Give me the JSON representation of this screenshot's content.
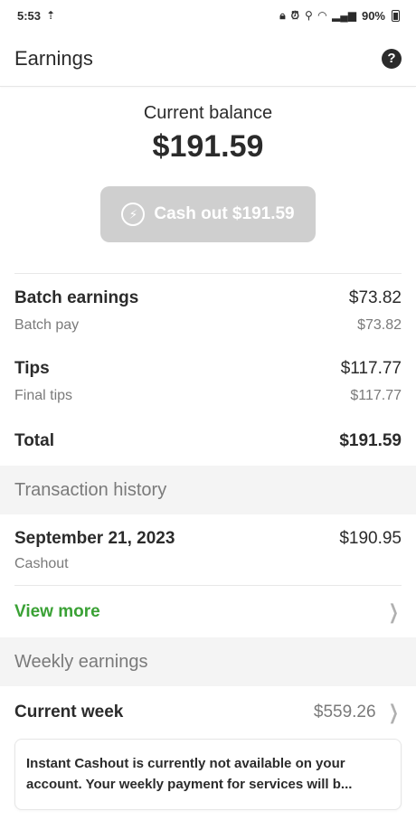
{
  "status_bar": {
    "time": "5:53",
    "left_icon": "network-speed-icon",
    "battery": "90%"
  },
  "app_bar": {
    "title": "Earnings",
    "help_icon": "help-icon",
    "help_glyph": "?"
  },
  "balance": {
    "label": "Current balance",
    "amount": "$191.59",
    "cashout_label": "Cash out $191.59",
    "cashout_icon": "bolt-icon",
    "cashout_enabled": false
  },
  "earnings": {
    "batch_label": "Batch earnings",
    "batch_value": "$73.82",
    "batch_sub_label": "Batch pay",
    "batch_sub_value": "$73.82",
    "tips_label": "Tips",
    "tips_value": "$117.77",
    "tips_sub_label": "Final tips",
    "tips_sub_value": "$117.77",
    "total_label": "Total",
    "total_value": "$191.59"
  },
  "transaction_history": {
    "title": "Transaction history",
    "items": [
      {
        "date": "September 21, 2023",
        "type": "Cashout",
        "amount": "$190.95"
      }
    ],
    "view_more_label": "View more"
  },
  "weekly_earnings": {
    "title": "Weekly earnings",
    "current_week_label": "Current week",
    "current_week_value": "$559.26"
  },
  "notice": {
    "text": "Instant Cashout is currently not available on your account. Your weekly payment for services will b..."
  },
  "colors": {
    "accent_green": "#3aa135",
    "disabled_button": "#cfcfcf",
    "section_bg": "#f4f4f4"
  }
}
